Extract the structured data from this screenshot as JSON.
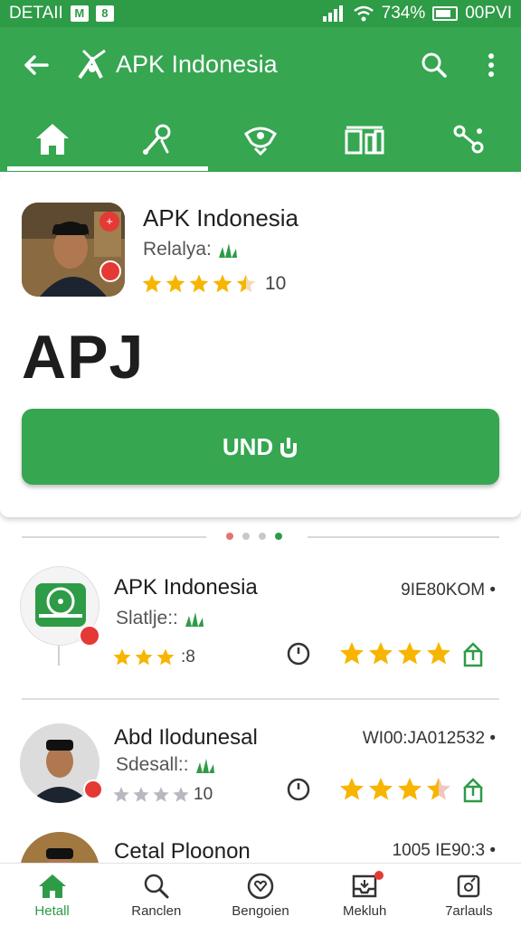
{
  "status_bar": {
    "carrier": "DETAII",
    "right_text": "734%",
    "time": "00PVI"
  },
  "app_bar": {
    "title": "APK Indonesia",
    "back_icon": "back-arrow-icon",
    "search_icon": "search-icon",
    "menu_icon": "more-vert-icon"
  },
  "tabs": [
    {
      "icon": "home-icon",
      "active": true
    },
    {
      "icon": "tools-icon",
      "active": false
    },
    {
      "icon": "eye-icon",
      "active": false
    },
    {
      "icon": "grid-icon",
      "active": false
    },
    {
      "icon": "share-icon",
      "active": false
    }
  ],
  "featured": {
    "name": "APK Indonesia",
    "subtitle": "Relalya:",
    "rating_stars": 4.5,
    "rating_count": "10",
    "big_label_main": "AP",
    "big_label_accent": "J",
    "install_label": "UND"
  },
  "pager": {
    "count": 4,
    "active_index": 3
  },
  "list": [
    {
      "name": "APK Indonesia",
      "subtitle": "Slatlje::",
      "meta": "9IE80KOM",
      "small_rating": ":8",
      "small_stars": 3,
      "big_stars": 4
    },
    {
      "name": "Abd Ilodunesal",
      "subtitle": "Sdesall::",
      "meta": "WI00:JA012532",
      "small_rating": "10",
      "small_stars": 0,
      "big_stars": 3.5
    },
    {
      "name": "Cetal Ploonon",
      "meta": "1005 IE90:3"
    }
  ],
  "bottom_nav": [
    {
      "label": "Hetall",
      "icon": "home-icon",
      "active": true
    },
    {
      "label": "Ranclen",
      "icon": "search-icon",
      "active": false
    },
    {
      "label": "Bengoien",
      "icon": "heart-icon",
      "active": false
    },
    {
      "label": "Mekluh",
      "icon": "inbox-icon",
      "active": false
    },
    {
      "label": "7arlauls",
      "icon": "settings-icon",
      "active": false
    }
  ],
  "colors": {
    "primary": "#36a651",
    "status": "#2e9b47",
    "star": "#f7b500",
    "badge": "#e53935"
  }
}
